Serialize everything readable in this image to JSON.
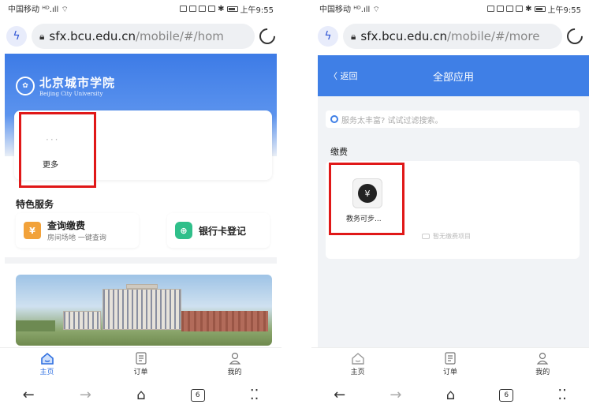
{
  "status": {
    "carrier": "中国移动",
    "signal": "ᴴᴰ.ıll ⌔",
    "time": "上午9:55"
  },
  "left": {
    "url_host": "sfx.bcu.edu.cn",
    "url_path": "/mobile/#/hom",
    "logo": {
      "cn": "北京城市学院",
      "en": "Beijing City University"
    },
    "more_dots": "···",
    "more_label": "更多",
    "section_title": "特色服务",
    "services": [
      {
        "name": "查询缴费",
        "sub": "房间场地 一键查询",
        "icon": "¥",
        "color": "#f2a23a"
      },
      {
        "name": "银行卡登记",
        "sub": "",
        "icon": "⊕",
        "color": "#2fbf8a"
      }
    ]
  },
  "right": {
    "url_host": "sfx.bcu.edu.cn",
    "url_path": "/mobile/#/more",
    "back_label": "〈 返回",
    "title": "全部应用",
    "search_placeholder": "服务太丰富? 试试过滤搜索。",
    "category": "缴费",
    "app_name": "教务可步...",
    "empty_label": "暂无缴费项目"
  },
  "tabs": [
    {
      "label": "主页",
      "active": true
    },
    {
      "label": "订单",
      "active": false
    },
    {
      "label": "我的",
      "active": false
    }
  ],
  "nav": {
    "tab_count": "6"
  }
}
